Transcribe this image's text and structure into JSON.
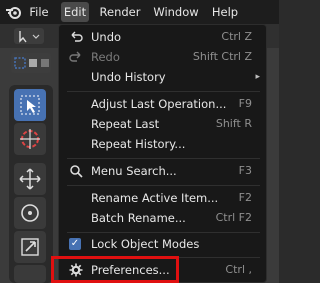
{
  "menubar": {
    "items": [
      {
        "label": "File"
      },
      {
        "label": "Edit"
      },
      {
        "label": "Render"
      },
      {
        "label": "Window"
      },
      {
        "label": "Help"
      }
    ]
  },
  "edit_menu": {
    "items": [
      {
        "label": "Undo",
        "shortcut": "Ctrl Z"
      },
      {
        "label": "Redo",
        "shortcut": "Shift Ctrl Z"
      },
      {
        "label": "Undo History"
      },
      {
        "label": "Adjust Last Operation...",
        "shortcut": "F9"
      },
      {
        "label": "Repeat Last",
        "shortcut": "Shift R"
      },
      {
        "label": "Repeat History..."
      },
      {
        "label": "Menu Search...",
        "shortcut": "F3"
      },
      {
        "label": "Rename Active Item...",
        "shortcut": "F2"
      },
      {
        "label": "Batch Rename...",
        "shortcut": "Ctrl F2"
      },
      {
        "label": "Lock Object Modes",
        "checked": true
      },
      {
        "label": "Preferences...",
        "shortcut": "Ctrl ,"
      }
    ]
  },
  "colors": {
    "menu_bg": "#181818",
    "accent": "#4772b3",
    "highlight_box": "#e01010"
  }
}
